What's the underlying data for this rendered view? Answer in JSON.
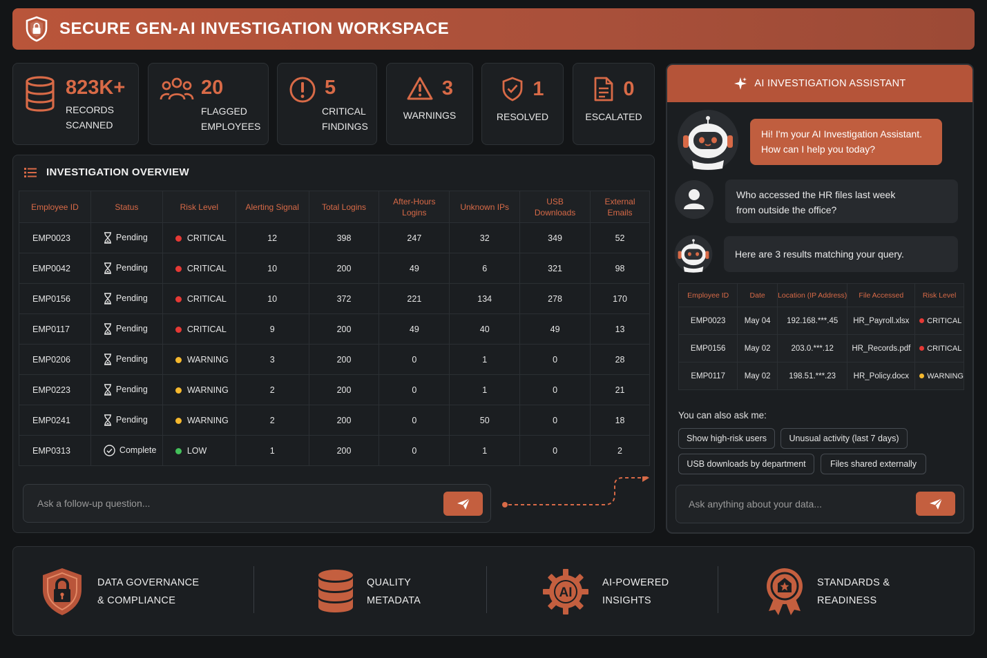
{
  "header": {
    "title": "SECURE GEN-AI INVESTIGATION WORKSPACE"
  },
  "stats": [
    {
      "value": "823K+",
      "label": "RECORDS\nSCANNED",
      "icon": "database-icon"
    },
    {
      "value": "20",
      "label": "FLAGGED\nEMPLOYEES",
      "icon": "users-icon"
    },
    {
      "value": "5",
      "label": "CRITICAL\nFINDINGS",
      "icon": "alert-circle-icon"
    },
    {
      "value": "3",
      "label": "WARNINGS",
      "icon": "warning-triangle-icon"
    },
    {
      "value": "1",
      "label": "RESOLVED",
      "icon": "shield-check-icon"
    },
    {
      "value": "0",
      "label": "ESCALATED",
      "icon": "document-icon"
    }
  ],
  "overview": {
    "title": "INVESTIGATION OVERVIEW",
    "columns": [
      "Employee ID",
      "Status",
      "Risk Level",
      "Alerting Signal",
      "Total Logins",
      "After-Hours Logins",
      "Unknown IPs",
      "USB Downloads",
      "External Emails"
    ],
    "rows": [
      {
        "id": "EMP0023",
        "status": "Pending",
        "risk": "CRITICAL",
        "alerting": "12",
        "logins": "398",
        "after_hours": "247",
        "unknown_ips": "32",
        "usb": "349",
        "emails": "52"
      },
      {
        "id": "EMP0042",
        "status": "Pending",
        "risk": "CRITICAL",
        "alerting": "10",
        "logins": "200",
        "after_hours": "49",
        "unknown_ips": "6",
        "usb": "321",
        "emails": "98"
      },
      {
        "id": "EMP0156",
        "status": "Pending",
        "risk": "CRITICAL",
        "alerting": "10",
        "logins": "372",
        "after_hours": "221",
        "unknown_ips": "134",
        "usb": "278",
        "emails": "170"
      },
      {
        "id": "EMP0117",
        "status": "Pending",
        "risk": "CRITICAL",
        "alerting": "9",
        "logins": "200",
        "after_hours": "49",
        "unknown_ips": "40",
        "usb": "49",
        "emails": "13"
      },
      {
        "id": "EMP0206",
        "status": "Pending",
        "risk": "WARNING",
        "alerting": "3",
        "logins": "200",
        "after_hours": "0",
        "unknown_ips": "1",
        "usb": "0",
        "emails": "28"
      },
      {
        "id": "EMP0223",
        "status": "Pending",
        "risk": "WARNING",
        "alerting": "2",
        "logins": "200",
        "after_hours": "0",
        "unknown_ips": "1",
        "usb": "0",
        "emails": "21"
      },
      {
        "id": "EMP0241",
        "status": "Pending",
        "risk": "WARNING",
        "alerting": "2",
        "logins": "200",
        "after_hours": "0",
        "unknown_ips": "50",
        "usb": "0",
        "emails": "18"
      },
      {
        "id": "EMP0313",
        "status": "Complete",
        "risk": "LOW",
        "alerting": "1",
        "logins": "200",
        "after_hours": "0",
        "unknown_ips": "1",
        "usb": "0",
        "emails": "2"
      }
    ],
    "ask_placeholder": "Ask a follow-up question..."
  },
  "risk_colors": {
    "CRITICAL": "#e53935",
    "WARNING": "#f5b82e",
    "LOW": "#43c05a"
  },
  "assistant": {
    "title": "AI INVESTIGATION ASSISTANT",
    "greeting": "Hi! I'm your AI Investigation Assistant.\nHow can I help you today?",
    "user_question": "Who accessed the HR files last week\nfrom outside the office?",
    "reply": "Here are 3 results matching your query.",
    "results_columns": [
      "Employee ID",
      "Date",
      "Location (IP Address)",
      "File Accessed",
      "Risk Level"
    ],
    "results": [
      {
        "id": "EMP0023",
        "date": "May 04",
        "ip": "192.168.***.45",
        "file": "HR_Payroll.xlsx",
        "risk": "CRITICAL"
      },
      {
        "id": "EMP0156",
        "date": "May 02",
        "ip": "203.0.***.12",
        "file": "HR_Records.pdf",
        "risk": "CRITICAL"
      },
      {
        "id": "EMP0117",
        "date": "May 02",
        "ip": "198.51.***.23",
        "file": "HR_Policy.docx",
        "risk": "WARNING"
      }
    ],
    "also_ask": "You can also ask me:",
    "suggestions": [
      "Show high-risk users",
      "Unusual activity (last 7 days)",
      "USB downloads by department",
      "Files shared externally"
    ],
    "ask_placeholder": "Ask anything about your data..."
  },
  "footer": [
    {
      "label": "DATA GOVERNANCE\n& COMPLIANCE",
      "icon": "lock-shield-icon"
    },
    {
      "label": "QUALITY\nMETADATA",
      "icon": "database-stack-icon"
    },
    {
      "label": "AI-POWERED\nINSIGHTS",
      "icon": "ai-gear-icon"
    },
    {
      "label": "STANDARDS &\nREADINESS",
      "icon": "award-badge-icon"
    }
  ]
}
